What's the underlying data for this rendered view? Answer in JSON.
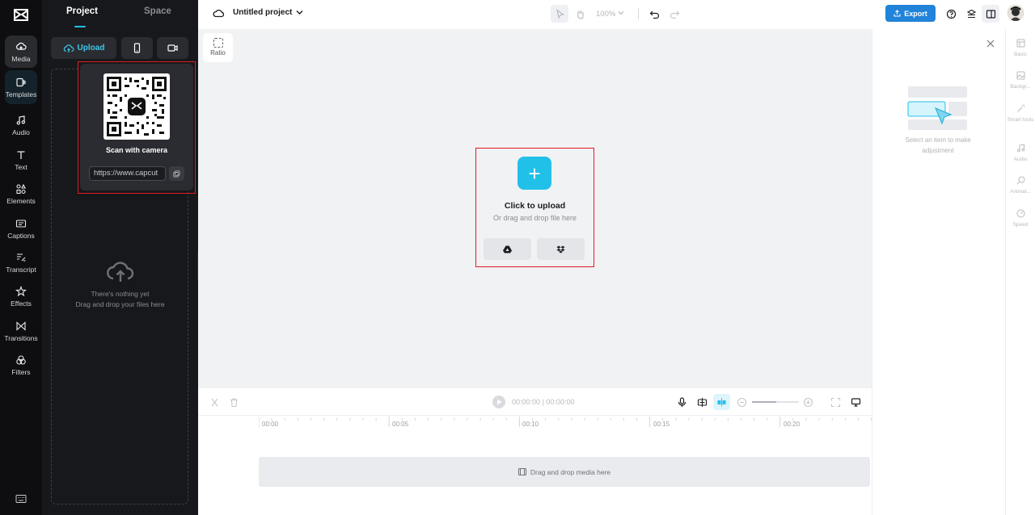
{
  "rail": {
    "items": [
      {
        "label": "Media",
        "icon": "media-icon"
      },
      {
        "label": "Templates",
        "icon": "templates-icon"
      },
      {
        "label": "Audio",
        "icon": "audio-icon"
      },
      {
        "label": "Text",
        "icon": "text-icon"
      },
      {
        "label": "Elements",
        "icon": "elements-icon"
      },
      {
        "label": "Captions",
        "icon": "captions-icon"
      },
      {
        "label": "Transcript",
        "icon": "transcript-icon"
      },
      {
        "label": "Effects",
        "icon": "effects-icon"
      },
      {
        "label": "Transitions",
        "icon": "transitions-icon"
      },
      {
        "label": "Filters",
        "icon": "filters-icon"
      }
    ]
  },
  "panel": {
    "tabs": [
      "Project",
      "Space"
    ],
    "upload_label": "Upload",
    "empty_line1": "There's nothing yet",
    "empty_line2": "Drag and drop your files here"
  },
  "qr": {
    "caption": "Scan with camera",
    "url": "https://www.capcut"
  },
  "topbar": {
    "project_title": "Untitled project",
    "zoom": "100%",
    "export_label": "Export"
  },
  "canvas": {
    "ratio_label": "Ratio",
    "upload_title": "Click to upload",
    "upload_sub": "Or drag and drop file here"
  },
  "timeline": {
    "current_time": "00:00:00",
    "divider": "|",
    "total_time": "00:00:00",
    "ticks": [
      "00:00",
      "00:05",
      "00:10",
      "00:15",
      "00:20"
    ],
    "track_hint": "Drag and drop media here"
  },
  "rpanel": {
    "hint": "Select an item to make adjustment",
    "tabs": [
      {
        "label": "Basic"
      },
      {
        "label": "Backgr..."
      },
      {
        "label": "Smart tools"
      },
      {
        "label": "Audio"
      },
      {
        "label": "Animat..."
      },
      {
        "label": "Speed"
      }
    ]
  },
  "colors": {
    "accent": "#21c0e9",
    "export": "#2183d9",
    "highlight_box": "#e21b23",
    "rail_bg": "#0e0e10",
    "panel_bg": "#17181b"
  }
}
